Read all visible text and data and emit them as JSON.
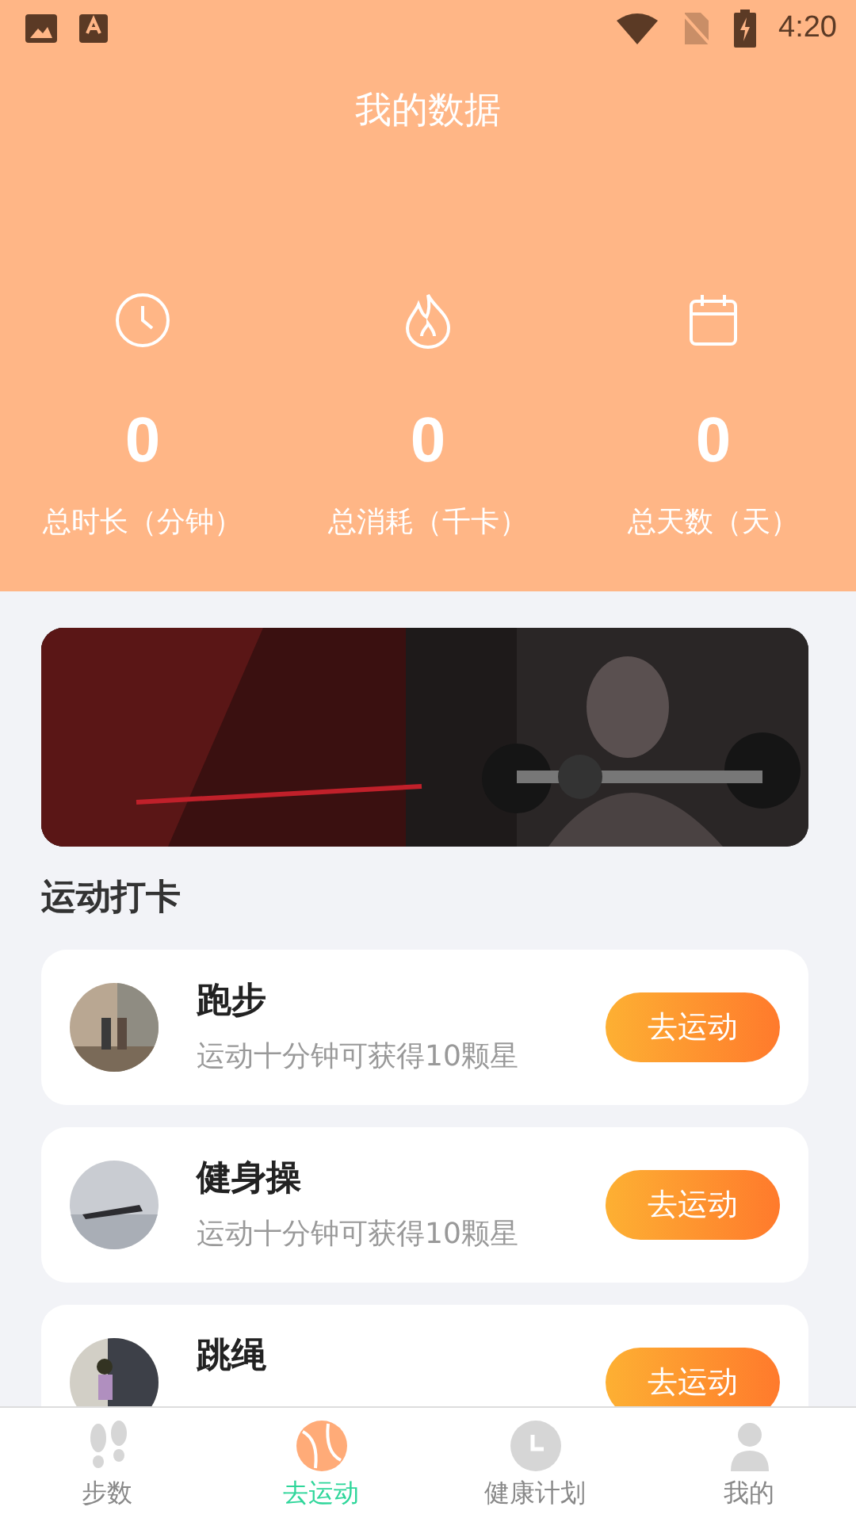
{
  "status_bar": {
    "time": "4:20"
  },
  "header": {
    "title": "我的数据"
  },
  "stats": [
    {
      "kind": "clock",
      "value": "0",
      "label": "总时长（分钟）"
    },
    {
      "kind": "flame",
      "value": "0",
      "label": "总消耗（千卡）"
    },
    {
      "kind": "calendar",
      "value": "0",
      "label": "总天数（天）"
    }
  ],
  "section_title": "运动打卡",
  "activities": [
    {
      "name": "跑步",
      "subtitle": "运动十分钟可获得10颗星",
      "button": "去运动"
    },
    {
      "name": "健身操",
      "subtitle": "运动十分钟可获得10颗星",
      "button": "去运动"
    },
    {
      "name": "跳绳",
      "button": "去运动"
    }
  ],
  "bottom_nav": [
    {
      "label": "步数",
      "selected": false
    },
    {
      "label": "去运动",
      "selected": true
    },
    {
      "label": "健康计划",
      "selected": false
    },
    {
      "label": "我的",
      "selected": false
    }
  ]
}
